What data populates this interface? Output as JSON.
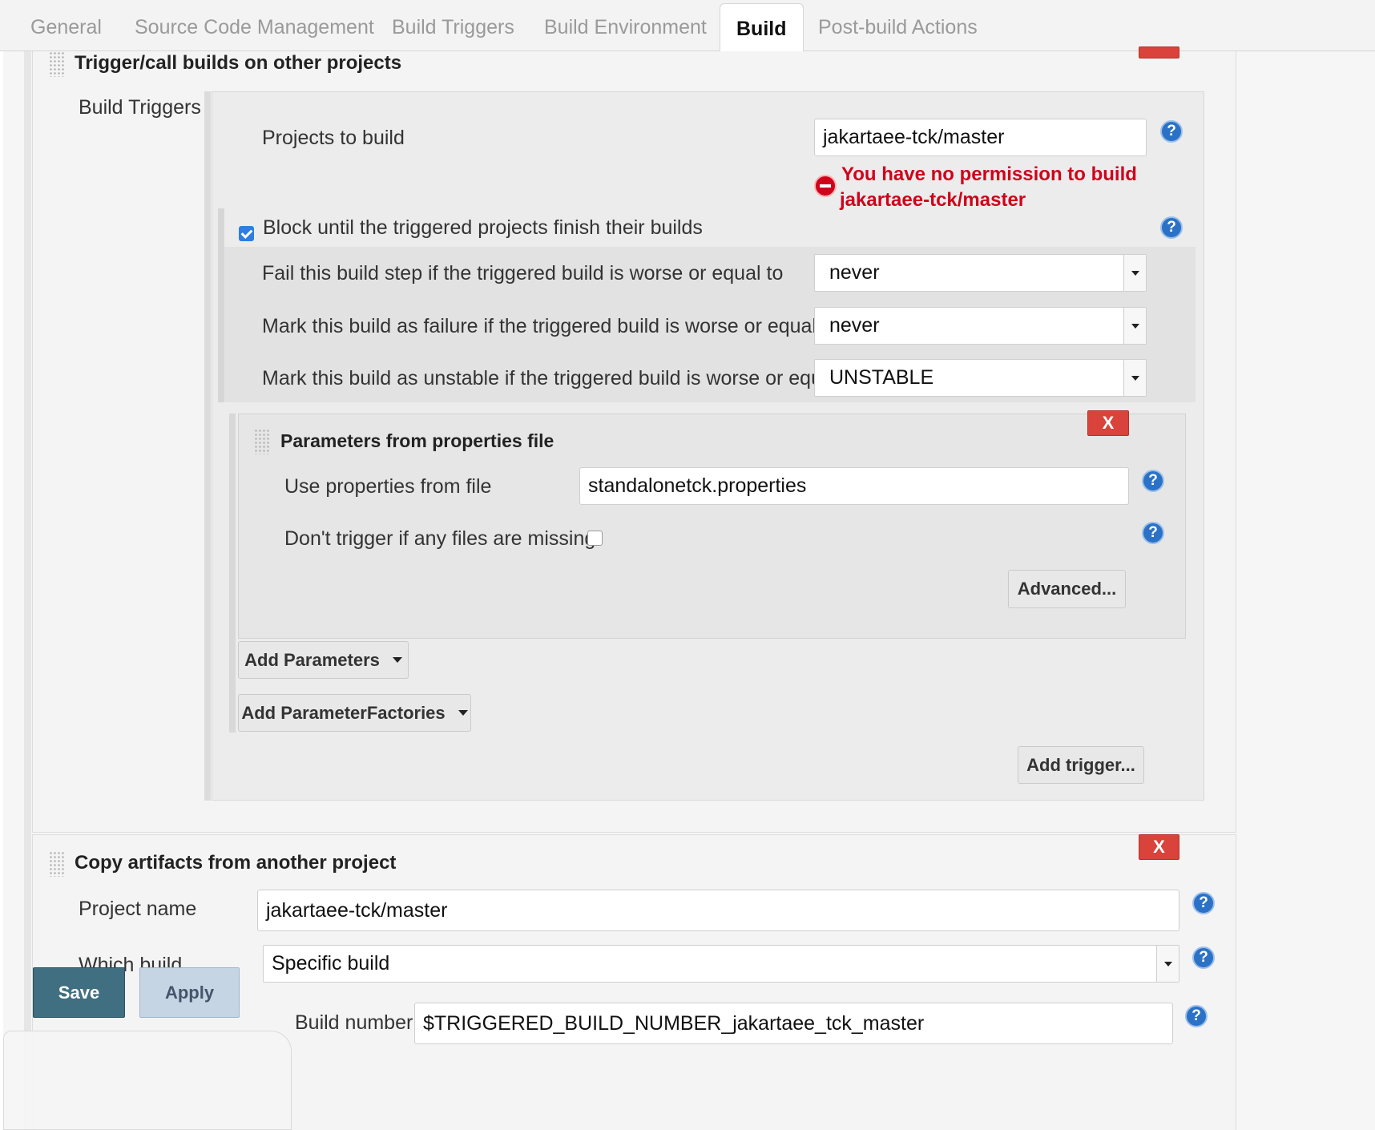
{
  "tabs": [
    {
      "label": "General"
    },
    {
      "label": "Source Code Management"
    },
    {
      "label": "Build Triggers"
    },
    {
      "label": "Build Environment"
    },
    {
      "label": "Build",
      "active": true
    },
    {
      "label": "Post-build Actions"
    }
  ],
  "trigger_step": {
    "title": "Trigger/call builds on other projects",
    "section_label": "Build Triggers",
    "projects_to_build": {
      "label": "Projects to build",
      "value": "jakartaee-tck/master"
    },
    "error": {
      "line1": "You have no permission to build",
      "line2": "jakartaee-tck/master"
    },
    "block_until": {
      "label": "Block until the triggered projects finish their builds",
      "checked": true
    },
    "fail_step": {
      "label": "Fail this build step if the triggered build is worse or equal to",
      "value": "never"
    },
    "mark_failure": {
      "label": "Mark this build as failure if the triggered build is worse or equal to",
      "value": "never"
    },
    "mark_unstable": {
      "label": "Mark this build as unstable if the triggered build is worse or equal to",
      "value": "UNSTABLE"
    },
    "params_file": {
      "title": "Parameters from properties file",
      "delete_label": "X",
      "use_file": {
        "label": "Use properties from file",
        "value": "standalonetck.properties"
      },
      "dont_trigger": {
        "label": "Don't trigger if any files are missing",
        "checked": false
      },
      "advanced_label": "Advanced..."
    },
    "add_parameters_label": "Add Parameters",
    "add_factories_label": "Add ParameterFactories",
    "add_trigger_label": "Add trigger..."
  },
  "copy_step": {
    "title": "Copy artifacts from another project",
    "delete_label": "X",
    "project_name": {
      "label": "Project name",
      "value": "jakartaee-tck/master"
    },
    "which_build": {
      "label": "Which build",
      "value": "Specific build"
    },
    "build_number": {
      "label": "Build number",
      "value": "$TRIGGERED_BUILD_NUMBER_jakartaee_tck_master"
    }
  },
  "footer": {
    "save_label": "Save",
    "apply_label": "Apply"
  },
  "help_symbol": "?",
  "colors": {
    "delete_button": "#d9433b",
    "error_text": "#d0021b",
    "help_icon": "#2b72c7",
    "save_button": "#3f6f80",
    "apply_button": "#c6d5e4",
    "checkbox_checked": "#2f7de1"
  },
  "icons": [
    "drag-handle-icon",
    "help-icon",
    "error-icon",
    "dropdown-arrow-icon",
    "checkbox-checked-icon"
  ]
}
